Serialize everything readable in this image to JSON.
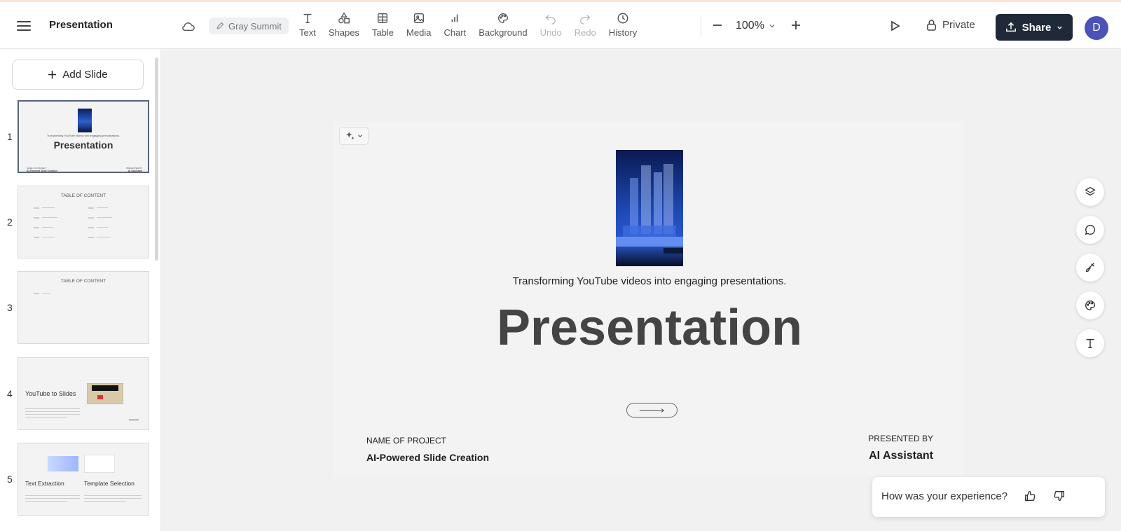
{
  "header": {
    "title": "Presentation",
    "theme_name": "Gray Summit",
    "tools": [
      {
        "label": "Text",
        "icon": "text-icon",
        "enabled": true
      },
      {
        "label": "Shapes",
        "icon": "shapes-icon",
        "enabled": true
      },
      {
        "label": "Table",
        "icon": "table-icon",
        "enabled": true
      },
      {
        "label": "Media",
        "icon": "media-icon",
        "enabled": true
      },
      {
        "label": "Chart",
        "icon": "chart-icon",
        "enabled": true
      },
      {
        "label": "Background",
        "icon": "palette-icon",
        "enabled": true
      },
      {
        "label": "Undo",
        "icon": "undo-icon",
        "enabled": false
      },
      {
        "label": "Redo",
        "icon": "redo-icon",
        "enabled": false
      },
      {
        "label": "History",
        "icon": "clock-icon",
        "enabled": true
      }
    ],
    "zoom": "100%",
    "visibility": "Private",
    "share_label": "Share",
    "avatar_initial": "D"
  },
  "sidebar": {
    "add_slide_label": "Add Slide",
    "slides": [
      {
        "number": "1",
        "subtitle": "Transforming YouTube videos into engaging presentations.",
        "title": "Presentation",
        "footer_left_label": "NAME OF PROJECT",
        "footer_left": "AI-Powered Slide Creation",
        "footer_right_label": "PRESENTED BY",
        "footer_right": "AI Assistant"
      },
      {
        "number": "2",
        "title": "TABLE OF CONTENT"
      },
      {
        "number": "3",
        "title": "TABLE OF CONTENT"
      },
      {
        "number": "4",
        "title": "YouTube to Slides"
      },
      {
        "number": "5",
        "title_left": "Text Extraction",
        "title_right": "Template Selection"
      }
    ]
  },
  "slide": {
    "subtitle": "Transforming YouTube videos into engaging presentations.",
    "title": "Presentation",
    "project_label": "NAME OF PROJECT",
    "project_name": "AI-Powered Slide Creation",
    "presenter_label": "PRESENTED BY",
    "presenter_name": "AI Assistant"
  },
  "right_tools": [
    "layers-icon",
    "comment-icon",
    "brush-icon",
    "palette-icon",
    "text-icon"
  ],
  "feedback": {
    "question": "How was your experience?"
  },
  "colors": {
    "accent_dark": "#1f2937",
    "avatar": "#4b52b8",
    "title_gray": "#444444"
  }
}
